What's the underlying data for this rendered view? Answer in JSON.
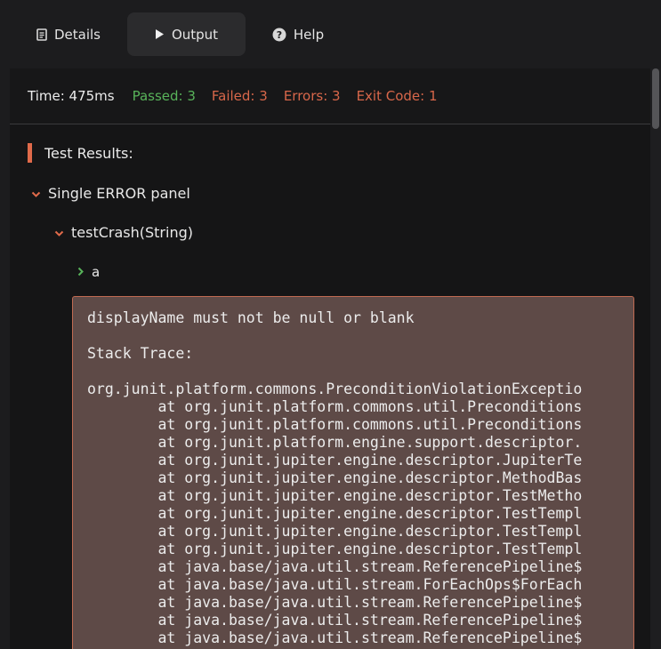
{
  "tabs": {
    "details": {
      "label": "Details",
      "icon": "document-icon"
    },
    "output": {
      "label": "Output",
      "icon": "play-icon"
    },
    "help": {
      "label": "Help",
      "icon": "help-circle-icon"
    }
  },
  "status": {
    "time": "Time: 475ms",
    "passed": "Passed: 3",
    "failed": "Failed: 3",
    "errors": "Errors: 3",
    "exit_code": "Exit Code: 1"
  },
  "results": {
    "heading": "Test Results:",
    "suite": "Single ERROR panel",
    "test": "testCrash(String)",
    "case": "a",
    "error_output": "displayName must not be null or blank\n\nStack Trace:\n\norg.junit.platform.commons.PreconditionViolationExceptio\n        at org.junit.platform.commons.util.Preconditions\n        at org.junit.platform.commons.util.Preconditions\n        at org.junit.platform.engine.support.descriptor.\n        at org.junit.jupiter.engine.descriptor.JupiterTe\n        at org.junit.jupiter.engine.descriptor.MethodBas\n        at org.junit.jupiter.engine.descriptor.TestMetho\n        at org.junit.jupiter.engine.descriptor.TestTempl\n        at org.junit.jupiter.engine.descriptor.TestTempl\n        at org.junit.jupiter.engine.descriptor.TestTempl\n        at java.base/java.util.stream.ReferencePipeline$\n        at java.base/java.util.stream.ForEachOps$ForEach\n        at java.base/java.util.stream.ReferencePipeline$\n        at java.base/java.util.stream.ReferencePipeline$\n        at java.base/java.util.stream.ReferencePipeline$"
  },
  "colors": {
    "passed": "#58b35a",
    "failed": "#d8674a",
    "accent": "#e06a4a",
    "error_bg": "#5e4a47"
  }
}
